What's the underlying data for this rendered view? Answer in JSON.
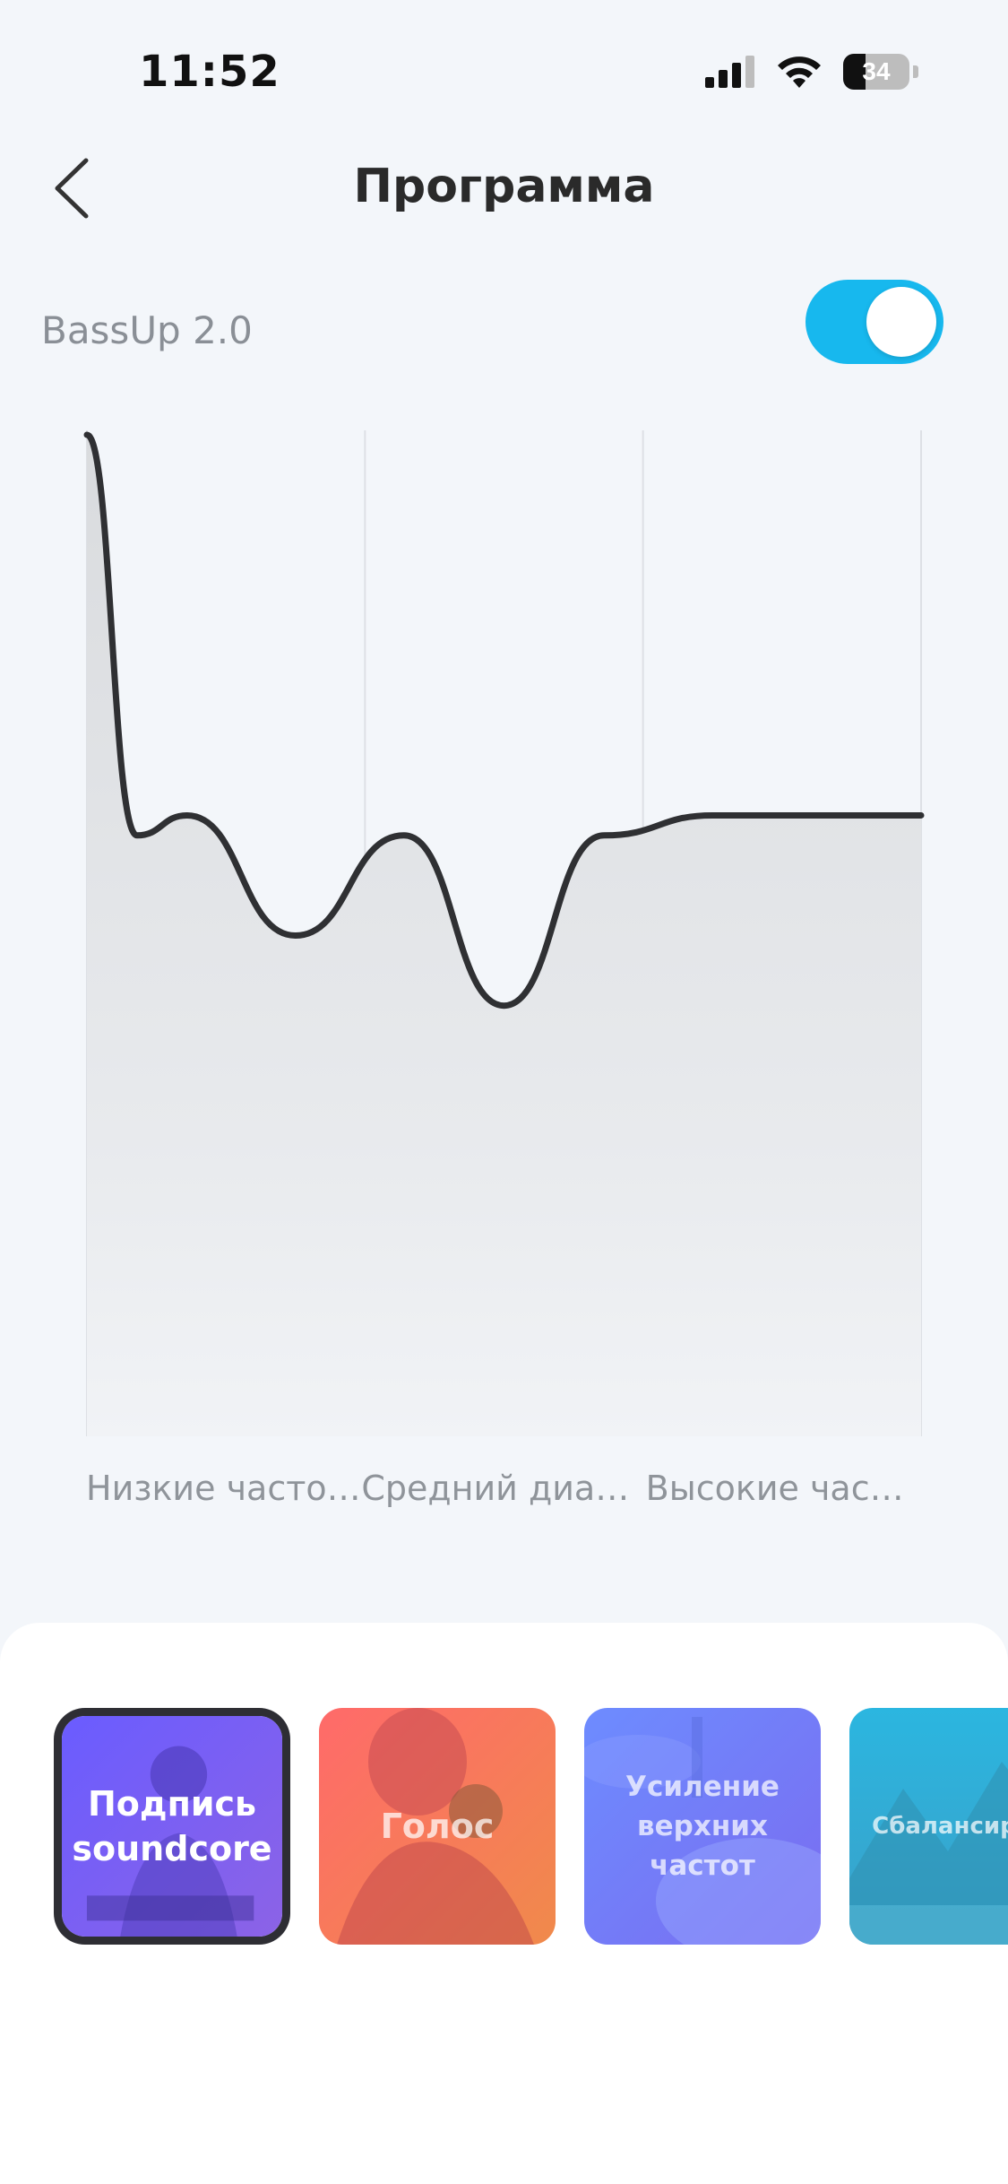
{
  "status_bar": {
    "time": "11:52",
    "battery_level": 34,
    "battery_label": "34"
  },
  "header": {
    "title": "Программа"
  },
  "bassup": {
    "label": "BassUp 2.0",
    "enabled": true,
    "accent_color": "#17b8ee"
  },
  "chart_data": {
    "type": "line",
    "categories": [
      "Низкие частот…",
      "Средний диап…",
      "Высокие част…"
    ],
    "x": [
      0,
      0.06,
      0.12,
      0.25,
      0.38,
      0.5,
      0.62,
      0.75,
      0.82,
      1.0
    ],
    "y": [
      1.0,
      0.6,
      0.62,
      0.5,
      0.6,
      0.43,
      0.6,
      0.62,
      0.62,
      0.62
    ],
    "ylim": [
      0,
      1
    ],
    "grid": true,
    "fill": true
  },
  "presets": [
    {
      "label": "Подпись soundcore",
      "selected": true,
      "icon": "dj-photo",
      "colors": [
        "#6a5cff",
        "#8c63e6"
      ]
    },
    {
      "label": "Голос",
      "selected": false,
      "icon": "singer-photo",
      "colors": [
        "#ff6a6a",
        "#f08a4b"
      ]
    },
    {
      "label": "Усиление верхних частот",
      "selected": false,
      "icon": "drum-photo",
      "colors": [
        "#6d8cff",
        "#7a6cf0"
      ]
    },
    {
      "label": "Сбалансирово",
      "selected": false,
      "icon": "landscape-photo",
      "colors": [
        "#2bb6e0",
        "#3aa0c8"
      ]
    }
  ]
}
